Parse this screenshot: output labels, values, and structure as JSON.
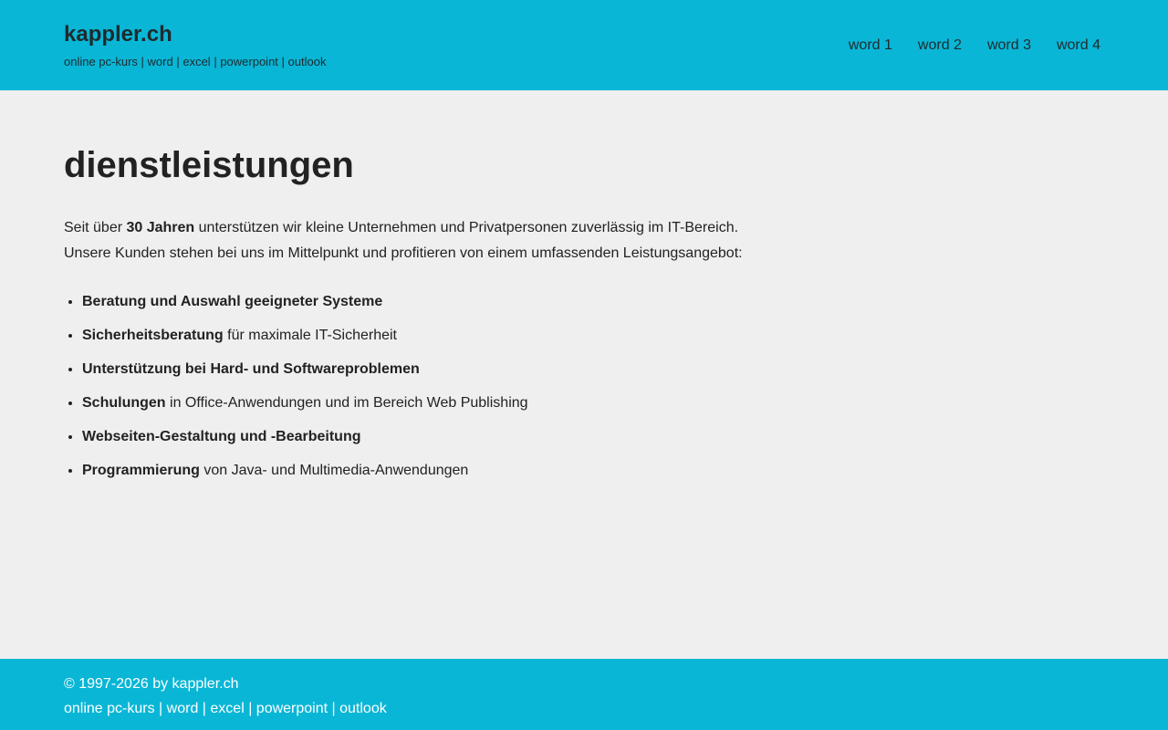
{
  "header": {
    "site_title": "kappler.ch",
    "tagline": {
      "parts": [
        "online pc-kurs",
        "word",
        "excel",
        "powerpoint",
        "outlook"
      ],
      "separator": " | "
    },
    "nav": [
      {
        "label": "word 1"
      },
      {
        "label": "word 2"
      },
      {
        "label": "word 3"
      },
      {
        "label": "word 4"
      }
    ]
  },
  "main": {
    "title": "dienstleistungen",
    "intro_line1": {
      "before": "Seit über ",
      "bold": "30 Jahren",
      "after": " unterstützen wir kleine Unternehmen und Privatpersonen zuverlässig im IT-Bereich."
    },
    "intro_line2": "Unsere Kunden stehen bei uns im Mittelpunkt und profitieren von einem umfassenden Leistungsangebot:",
    "services": [
      {
        "bold": "Beratung und Auswahl geeigneter Systeme",
        "rest": ""
      },
      {
        "bold": "Sicherheitsberatung",
        "rest": " für maximale IT-Sicherheit"
      },
      {
        "bold": "Unterstützung bei Hard- und Softwareproblemen",
        "rest": ""
      },
      {
        "bold": "Schulungen",
        "rest": " in Office-Anwendungen und im Bereich Web Publishing"
      },
      {
        "bold": "Webseiten-Gestaltung und -Bearbeitung",
        "rest": ""
      },
      {
        "bold": "Programmierung",
        "rest": " von Java- und Multimedia-Anwendungen"
      }
    ]
  },
  "footer": {
    "copyright": "© 1997-2026 by kappler.ch",
    "links": [
      "online pc-kurs",
      "word",
      "excel",
      "powerpoint",
      "outlook"
    ],
    "separator": " | "
  },
  "colors": {
    "header_bg": "#09b6d6",
    "footer_bg": "#09b6d6",
    "page_bg": "#efefef"
  }
}
